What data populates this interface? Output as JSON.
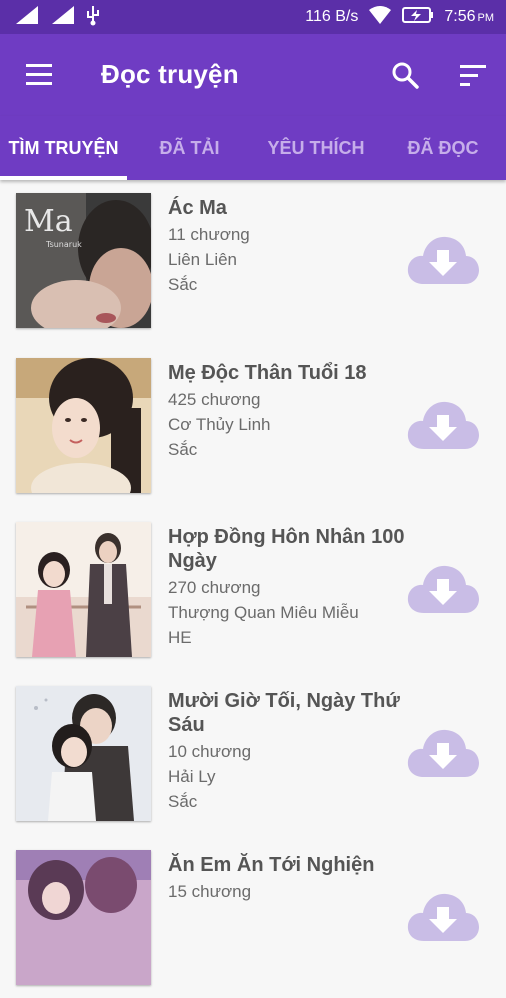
{
  "status_bar": {
    "speed": "116 B/s",
    "time": "7:56",
    "ampm": "PM"
  },
  "app_bar": {
    "title": "Đọc truyện"
  },
  "tabs": [
    {
      "label": "TÌM TRUYỆN",
      "active": true
    },
    {
      "label": "ĐÃ TẢI",
      "active": false
    },
    {
      "label": "YÊU THÍCH",
      "active": false
    },
    {
      "label": "ĐÃ ĐỌC",
      "active": false
    }
  ],
  "stories": [
    {
      "title": "Ác Ma",
      "chapters": "11 chương",
      "author": "Liên Liên",
      "status": "Sắc",
      "cover_text": "Ma",
      "cover_subtext": "Tsunaruk"
    },
    {
      "title": "Mẹ Độc Thân Tuổi 18",
      "chapters": "425 chương",
      "author": "Cơ Thủy Linh",
      "status": "Sắc"
    },
    {
      "title": "Hợp Đồng Hôn Nhân 100 Ngày",
      "chapters": "270 chương",
      "author": "Thượng Quan Miêu Miễu",
      "status": "HE"
    },
    {
      "title": "Mười Giờ Tối, Ngày Thứ Sáu",
      "chapters": "10 chương",
      "author": "Hải Ly",
      "status": "Sắc"
    },
    {
      "title": "Ăn Em Ăn Tới Nghiện",
      "chapters": "15 chương",
      "author": "",
      "status": ""
    }
  ],
  "colors": {
    "status_bar": "#5b2fa8",
    "primary": "#6f3cc3",
    "tab_inactive": "#c6aeea",
    "download_icon": "#c9bde6"
  },
  "icons": {
    "menu": "menu-icon",
    "search": "search-icon",
    "sort": "sort-icon",
    "download": "cloud-download-icon"
  }
}
